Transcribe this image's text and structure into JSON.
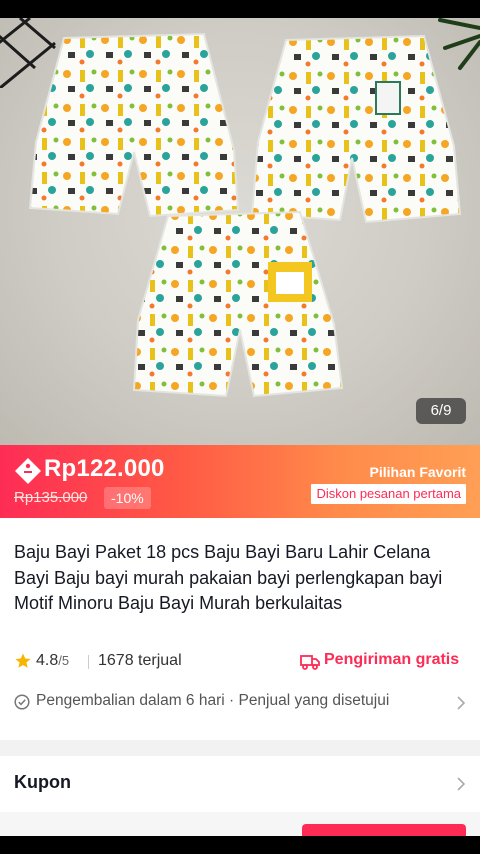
{
  "gallery": {
    "counter": "6/9",
    "image": "baby-shorts-product-photo"
  },
  "price": {
    "current": "Rp122.000",
    "original": "Rp135.000",
    "discount": "-10%",
    "favorite_label": "Pilihan Favorit",
    "favorite_badge": "Diskon pesanan pertama",
    "icon": "price-tag-icon"
  },
  "product": {
    "title": "Baju Bayi Paket 18 pcs Baju Bayi Baru Lahir Celana Bayi Baju bayi  murah pakaian bayi perlengkapan bayi Motif Minoru Baju Bayi Murah berkulaitas",
    "rating": "4.8",
    "rating_max": "/5",
    "sold": "1678 terjual",
    "shipping": "Pengiriman gratis",
    "returns": "Pengembalian dalam 6 hari · Penjual yang disetujui"
  },
  "sections": {
    "kupon": "Kupon"
  },
  "colors": {
    "accent": "#fe2c55",
    "banner_start": "#fe2c55",
    "banner_end": "#ff9f55",
    "star": "#f7b500"
  }
}
